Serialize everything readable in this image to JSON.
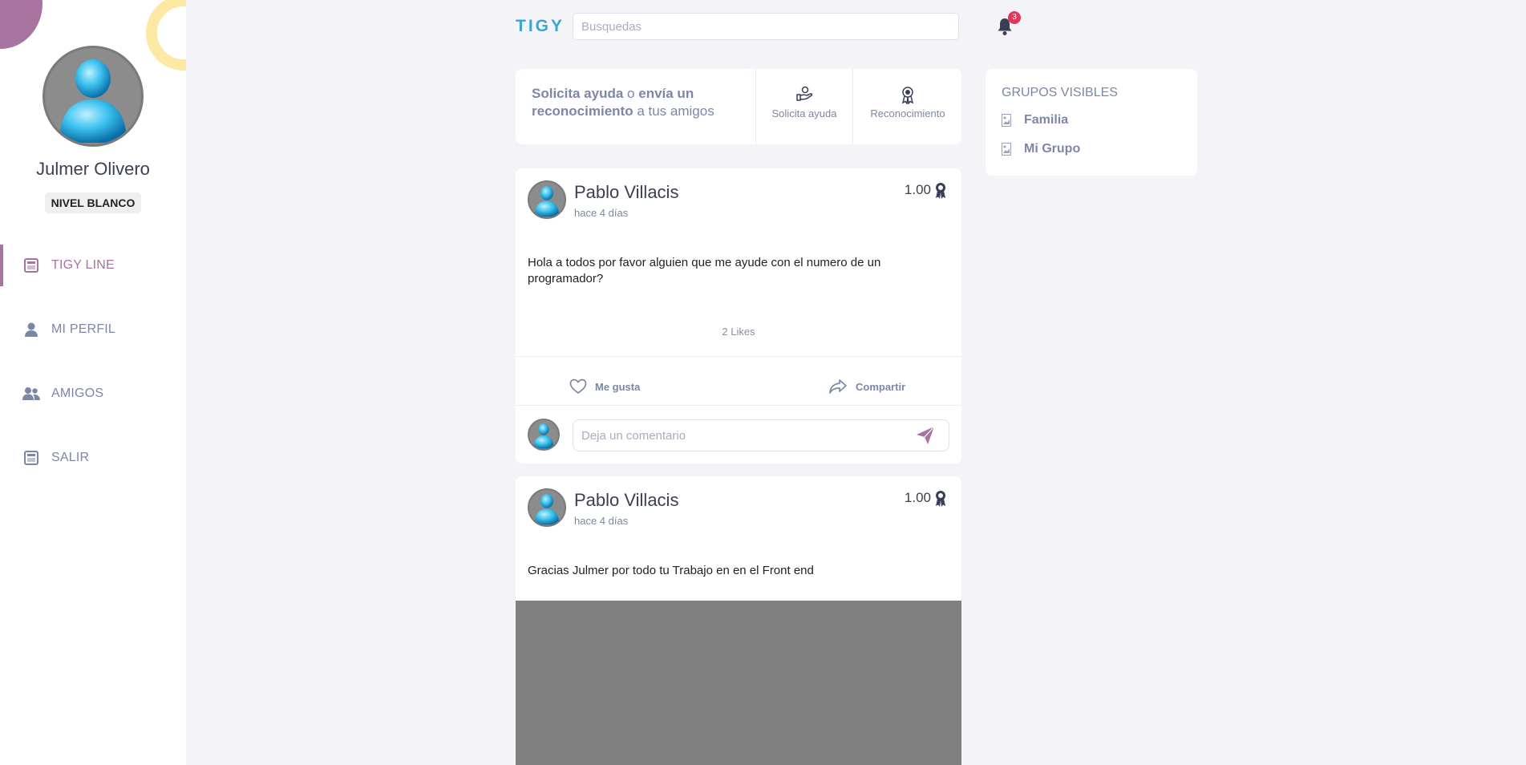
{
  "sidebar": {
    "user_name": "Julmer Olivero",
    "level": "NIVEL BLANCO",
    "nav": [
      {
        "label": "TIGY LINE",
        "icon": "calendar-icon",
        "active": true
      },
      {
        "label": "MI PERFIL",
        "icon": "user-icon",
        "active": false
      },
      {
        "label": "AMIGOS",
        "icon": "users-icon",
        "active": false
      },
      {
        "label": "SALIR",
        "icon": "calendar-icon",
        "active": false
      }
    ]
  },
  "header": {
    "logo": "TIGY",
    "search_placeholder": "Busquedas",
    "notification_count": "3"
  },
  "ask": {
    "text_bold1": "Solicita ayuda",
    "text_mid1": " o ",
    "text_bold2": "envía un reconocimiento",
    "text_mid2": " a tus amigos",
    "help_label": "Solicita ayuda",
    "recognition_label": "Reconocimiento"
  },
  "groups": {
    "title": "GRUPOS VISIBLES",
    "items": [
      "Familia",
      "Mi Grupo"
    ]
  },
  "posts": [
    {
      "author": "Pablo Villacis",
      "time": "hace 4 días",
      "score": "1.00",
      "body": "Hola a todos por favor alguien que me ayude con el numero de un programador?",
      "likes": "2 Likes",
      "like_label": "Me gusta",
      "share_label": "Compartir",
      "comment_placeholder": "Deja un comentario"
    },
    {
      "author": "Pablo Villacis",
      "time": "hace 4 días",
      "score": "1.00",
      "body": "Gracias Julmer por todo tu Trabajo en en el Front end"
    }
  ],
  "colors": {
    "accent": "#a6749f",
    "logo": "#3aa6cf",
    "nav_text": "#7c87a8",
    "badge": "#e2365a",
    "deco_yellow": "#fde9a4"
  }
}
